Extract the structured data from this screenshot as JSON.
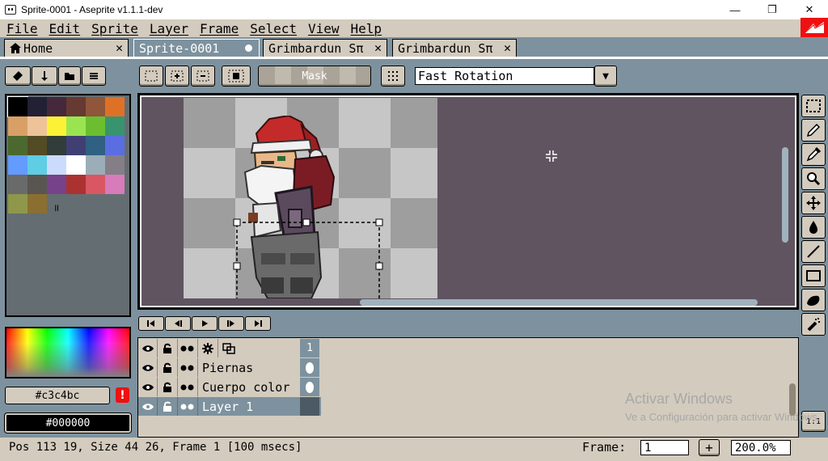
{
  "window": {
    "title": "Sprite-0001 - Aseprite v1.1.1-dev",
    "minimize": "—",
    "maximize": "❐",
    "close": "✕"
  },
  "menu": [
    "File",
    "Edit",
    "Sprite",
    "Layer",
    "Frame",
    "Select",
    "View",
    "Help"
  ],
  "tabs": [
    {
      "label": "Home",
      "close": "✕"
    },
    {
      "label": "Sprite-0001"
    },
    {
      "label": "Grimbardun Sπ",
      "close": "✕"
    },
    {
      "label": "Grimbardun Sπ",
      "close": "✕"
    }
  ],
  "context_bar": {
    "mask_label": "Mask",
    "rotation_algorithm": "Fast Rotation",
    "dropdown_arrow": "▼"
  },
  "palette": {
    "colors": [
      "#000000",
      "#222034",
      "#45283c",
      "#663931",
      "#8f563b",
      "#df7126",
      "#d9a066",
      "#eec39a",
      "#fbf236",
      "#99e550",
      "#6abe30",
      "#37946e",
      "#4b692f",
      "#524b24",
      "#323c39",
      "#3f3f74",
      "#306082",
      "#5b6ee1",
      "#639bff",
      "#5fcde4",
      "#cbdbfc",
      "#ffffff",
      "#9badb7",
      "#847e87",
      "#696a6a",
      "#595652",
      "#76428a",
      "#ac3232",
      "#d95763",
      "#d77bba",
      "#8f974a",
      "#8a6f30"
    ]
  },
  "foreground_color": "#c3c4bc",
  "background_color": "#000000",
  "warning_icon": "!",
  "layers": [
    {
      "name": "",
      "frame_number": "1"
    },
    {
      "name": "Piernas"
    },
    {
      "name": "Cuerpo color"
    },
    {
      "name": "Layer 1"
    }
  ],
  "watermark": {
    "title": "Activar Windows",
    "subtitle": "Ve a Configuración para activar Windows."
  },
  "status": {
    "text": "Pos 113 19, Size 44 26, Frame 1 [100 msecs]",
    "frame_label": "Frame:",
    "frame_value": "1",
    "add_label": "+",
    "zoom": "200.0%"
  },
  "tools": [
    "rectangular-marquee",
    "pencil",
    "eyedropper",
    "zoom",
    "move",
    "paint-bucket",
    "line",
    "rectangle",
    "contour",
    "spray"
  ],
  "one_to_one": "1:1"
}
